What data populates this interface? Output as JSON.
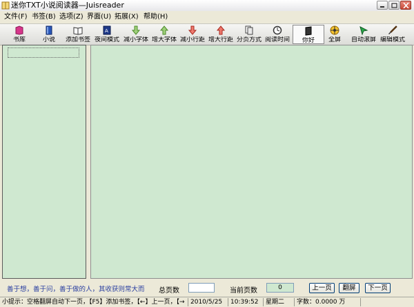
{
  "window": {
    "title": "迷你TXT小说阅读器—Juisreader"
  },
  "menu": [
    {
      "label": "文件(F)"
    },
    {
      "label": "书签(B)"
    },
    {
      "label": "选项(Z)"
    },
    {
      "label": "界面(U)"
    },
    {
      "label": "拓展(X)"
    },
    {
      "label": "帮助(H)"
    }
  ],
  "toolbar": [
    {
      "label": "书库",
      "icon": "bookshelf-icon",
      "color": "#d6368a"
    },
    {
      "label": "小说",
      "icon": "book-icon",
      "color": "#2856b8"
    },
    {
      "label": "添加书签",
      "icon": "open-book-icon",
      "color": "#333333"
    },
    {
      "label": "夜间模式",
      "icon": "night-mode-icon",
      "color": "#2b4aa8"
    },
    {
      "label": "减小字体",
      "icon": "arrow-down-green-icon",
      "color": "#7bbf4c"
    },
    {
      "label": "增大字体",
      "icon": "arrow-up-green-icon",
      "color": "#7bbf4c"
    },
    {
      "label": "减小行距",
      "icon": "arrow-down-red-icon",
      "color": "#d9443a"
    },
    {
      "label": "增大行距",
      "icon": "arrow-up-red-icon",
      "color": "#d9443a"
    },
    {
      "label": "分页方式",
      "icon": "page-split-icon",
      "color": "#444444"
    },
    {
      "label": "阅读时间",
      "icon": "clock-icon",
      "color": "#444444"
    },
    {
      "label": "你好",
      "icon": "dark-book-icon",
      "color": "#222222",
      "active": true
    },
    {
      "label": "全屏",
      "icon": "fullscreen-icon",
      "color": "#e0a020"
    },
    {
      "label": "自动滚屏",
      "icon": "autoscroll-icon",
      "color": "#2aa84a"
    },
    {
      "label": "编辑模式",
      "icon": "edit-brush-icon",
      "color": "#8a5a2a"
    }
  ],
  "bottom": {
    "hint": "善于想，善于问，善于做的人，其收获则常大而",
    "total_pages_label": "总页数",
    "total_pages_value": "",
    "current_page_label": "当前页数",
    "current_page_value": "0",
    "prev_page_label": "上一页",
    "fullscreen_label": "翻屏",
    "next_page_label": "下一页"
  },
  "status": {
    "tip": "小提示：空格翻屏自动下一页，【F5】添加书签，【←】上一页，【→",
    "date": "2010/5/25",
    "time": "10:39:52",
    "weekday": "星期二",
    "wordcount": "字数：0.0000 万"
  },
  "colors": {
    "reading_bg": "#cfe8d0",
    "hint_text": "#2a3fa0",
    "current_page_bg": "#cfe8d0"
  }
}
